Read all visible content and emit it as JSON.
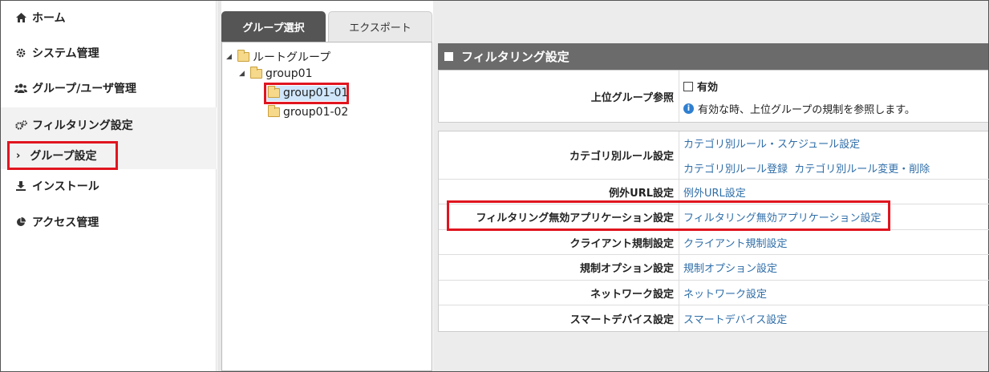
{
  "sidebar": {
    "items": [
      {
        "label": "ホーム",
        "icon": "home-icon"
      },
      {
        "label": "システム管理",
        "icon": "gear-icon"
      },
      {
        "label": "グループ/ユーザ管理",
        "icon": "users-icon"
      },
      {
        "label": "フィルタリング設定",
        "icon": "gears-icon"
      },
      {
        "label": "インストール",
        "icon": "download-icon"
      },
      {
        "label": "アクセス管理",
        "icon": "pie-chart-icon"
      }
    ],
    "sub_item": {
      "label": "グループ設定",
      "icon": "chevron-right-icon"
    }
  },
  "tabs": [
    {
      "label": "グループ選択",
      "active": true
    },
    {
      "label": "エクスポート",
      "active": false
    }
  ],
  "tree": {
    "root": "ルートグループ",
    "group": "group01",
    "children": [
      "group01-01",
      "group01-02"
    ],
    "selected": "group01-01"
  },
  "panel": {
    "title": "フィルタリング設定",
    "parent_ref": {
      "label": "上位グループ参照",
      "checkbox_label": "有効",
      "info": "有効な時、上位グループの規制を参照します。"
    },
    "rows": [
      {
        "label": "カテゴリ別ルール設定",
        "links": [
          "カテゴリ別ルール・スケジュール設定"
        ],
        "links2": [
          "カテゴリ別ルール登録",
          "カテゴリ別ルール変更・削除"
        ]
      },
      {
        "label": "例外URL設定",
        "links": [
          "例外URL設定"
        ]
      },
      {
        "label": "フィルタリング無効アプリケーション設定",
        "links": [
          "フィルタリング無効アプリケーション設定"
        ]
      },
      {
        "label": "クライアント規制設定",
        "links": [
          "クライアント規制設定"
        ]
      },
      {
        "label": "規制オプション設定",
        "links": [
          "規制オプション設定"
        ]
      },
      {
        "label": "ネットワーク設定",
        "links": [
          "ネットワーク設定"
        ]
      },
      {
        "label": "スマートデバイス設定",
        "links": [
          "スマートデバイス設定"
        ]
      }
    ]
  },
  "colors": {
    "highlight": "#e0151f",
    "link": "#2f6ea8",
    "header": "#6b6b6b",
    "tab_active": "#555555",
    "selected_node": "#cfe6fb"
  }
}
